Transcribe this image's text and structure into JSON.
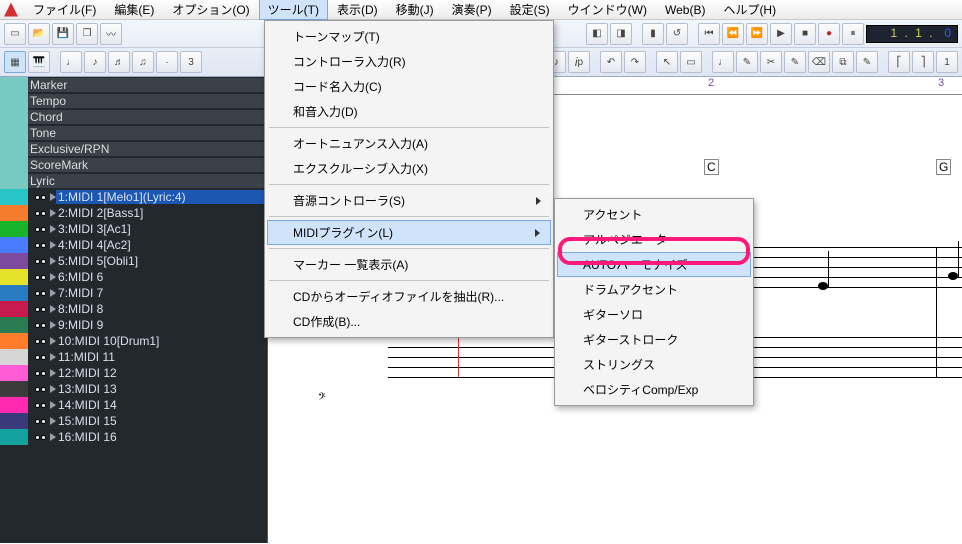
{
  "menubar": {
    "items": [
      "ファイル(F)",
      "編集(E)",
      "オプション(O)",
      "ツール(T)",
      "表示(D)",
      "移動(J)",
      "演奏(P)",
      "設定(S)",
      "ウインドウ(W)",
      "Web(B)",
      "ヘルプ(H)"
    ]
  },
  "counter": {
    "prefix": "1 . 1 .",
    "zero": "0"
  },
  "track_sections": [
    "Marker",
    "Tempo",
    "Chord",
    "Tone",
    "Exclusive/RPN",
    "ScoreMark",
    "Lyric"
  ],
  "tracks": [
    {
      "color": "#29c4c7",
      "label": "1:MIDI 1[Melo1](Lyric:4)",
      "selected": true
    },
    {
      "color": "#f47c2c",
      "label": "2:MIDI 2[Bass1]"
    },
    {
      "color": "#18b22b",
      "label": "3:MIDI 3[Ac1]"
    },
    {
      "color": "#4a7cff",
      "label": "4:MIDI 4[Ac2]"
    },
    {
      "color": "#7c4a9e",
      "label": "5:MIDI 5[Obli1]"
    },
    {
      "color": "#e6e12a",
      "label": "6:MIDI 6"
    },
    {
      "color": "#2a7cc2",
      "label": "7:MIDI 7"
    },
    {
      "color": "#c71b4e",
      "label": "8:MIDI 8"
    },
    {
      "color": "#2a7c53",
      "label": "9:MIDI 9"
    },
    {
      "color": "#ff7c2a",
      "label": "10:MIDI 10[Drum1]"
    },
    {
      "color": "#d6d6d6",
      "label": "11:MIDI 11"
    },
    {
      "color": "#ff5cd6",
      "label": "12:MIDI 12"
    },
    {
      "color": "#3b3b3b",
      "label": "13:MIDI 13"
    },
    {
      "color": "#ff2ab0",
      "label": "14:MIDI 14"
    },
    {
      "color": "#3a3a7a",
      "label": "15:MIDI 15"
    },
    {
      "color": "#13a29e",
      "label": "16:MIDI 16"
    }
  ],
  "ruler": {
    "2": "2",
    "3": "3"
  },
  "chords": {
    "C": "C",
    "G": "G"
  },
  "menu_tools": {
    "items": [
      "トーンマップ(T)",
      "コントローラ入力(R)",
      "コード名入力(C)",
      "和音入力(D)",
      "-",
      "オートニュアンス入力(A)",
      "エクスクルーシブ入力(X)",
      "-",
      "音源コントローラ(S)",
      "-",
      "MIDIプラグイン(L)",
      "-",
      "マーカー 一覧表示(A)",
      "-",
      "CDからオーディオファイルを抽出(R)...",
      "CD作成(B)..."
    ],
    "submenu_flags": [
      false,
      false,
      false,
      false,
      null,
      false,
      false,
      null,
      true,
      null,
      true,
      null,
      false,
      null,
      false,
      false
    ],
    "highlighted": "MIDIプラグイン(L)"
  },
  "submenu_midi": {
    "items": [
      "アクセント",
      "アルペジエーター",
      "AUTOハーモナイズ",
      "ドラムアクセント",
      "ギターソロ",
      "ギターストローク",
      "ストリングス",
      "ベロシティComp/Exp"
    ],
    "highlighted": "AUTOハーモナイズ"
  }
}
